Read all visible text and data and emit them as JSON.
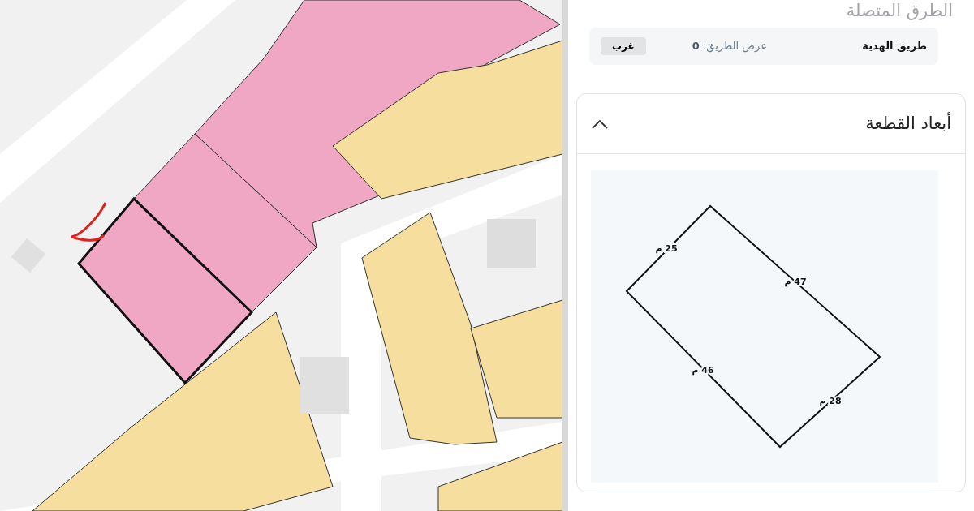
{
  "connected_roads": {
    "title": "الطرق المتصلة",
    "roads": [
      {
        "name": "طريق الهدية",
        "width_label": "عرض الطريق:",
        "width_value": "0",
        "direction": "غرب"
      }
    ]
  },
  "plot_dimensions": {
    "title": "أبعاد القطعة",
    "expanded": true,
    "sides": [
      {
        "label": "25 م"
      },
      {
        "label": "47 م"
      },
      {
        "label": "46 م"
      },
      {
        "label": "28 م"
      }
    ]
  }
}
